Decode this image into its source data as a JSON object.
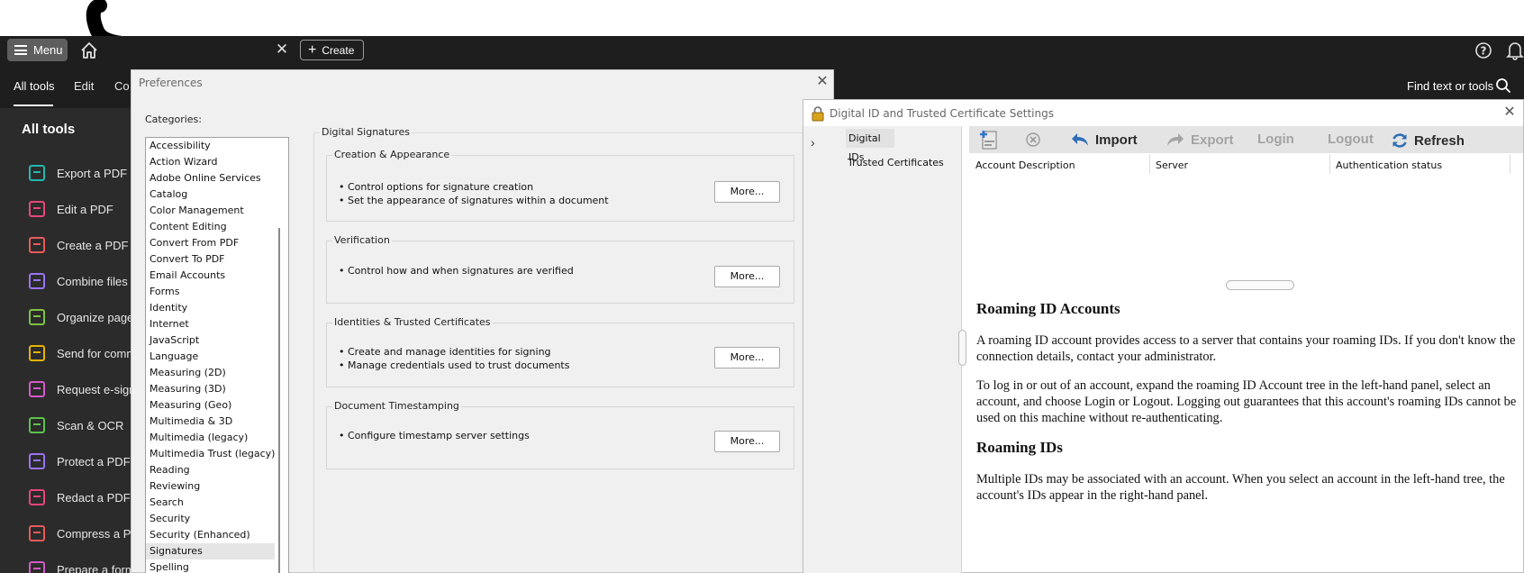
{
  "app": {
    "menu_label": "Menu",
    "create_label": "Create",
    "tabs": [
      "All tools",
      "Edit",
      "Co"
    ],
    "find_text": "Find text or tools"
  },
  "left_panel": {
    "heading": "All tools",
    "items": [
      {
        "label": "Export a PDF",
        "icon": "export-pdf-icon",
        "color": "#22b8b0"
      },
      {
        "label": "Edit a PDF",
        "icon": "edit-pdf-icon",
        "color": "#e8457a"
      },
      {
        "label": "Create a PDF",
        "icon": "create-pdf-icon",
        "color": "#ea5a5a"
      },
      {
        "label": "Combine files",
        "icon": "combine-files-icon",
        "color": "#9a74f2"
      },
      {
        "label": "Organize page",
        "icon": "organize-pages-icon",
        "color": "#7cc33f"
      },
      {
        "label": "Send for comm",
        "icon": "send-comments-icon",
        "color": "#e8b400"
      },
      {
        "label": "Request e-sign",
        "icon": "request-esign-icon",
        "color": "#d658c9"
      },
      {
        "label": "Scan & OCR",
        "icon": "scan-ocr-icon",
        "color": "#5cc34a"
      },
      {
        "label": "Protect a PDF",
        "icon": "protect-pdf-icon",
        "color": "#9a74f2"
      },
      {
        "label": "Redact a PDF",
        "icon": "redact-pdf-icon",
        "color": "#e8457a"
      },
      {
        "label": "Compress a PD",
        "icon": "compress-pdf-icon",
        "color": "#ea5a5a"
      },
      {
        "label": "Prepare a form",
        "icon": "prepare-form-icon",
        "color": "#d658c9"
      }
    ]
  },
  "preferences": {
    "title": "Preferences",
    "categories_label": "Categories:",
    "categories": [
      "Accessibility",
      "Action Wizard",
      "Adobe Online Services",
      "Catalog",
      "Color Management",
      "Content Editing",
      "Convert From PDF",
      "Convert To PDF",
      "Email Accounts",
      "Forms",
      "Identity",
      "Internet",
      "JavaScript",
      "Language",
      "Measuring (2D)",
      "Measuring (3D)",
      "Measuring (Geo)",
      "Multimedia & 3D",
      "Multimedia (legacy)",
      "Multimedia Trust (legacy)",
      "Reading",
      "Reviewing",
      "Search",
      "Security",
      "Security (Enhanced)",
      "Signatures",
      "Spelling"
    ],
    "selected_category": "Signatures",
    "section_title": "Digital Signatures",
    "groups": [
      {
        "title": "Creation & Appearance",
        "lines": [
          "• Control options for signature creation",
          "• Set the appearance of signatures within a document"
        ],
        "button": "More..."
      },
      {
        "title": "Verification",
        "lines": [
          "• Control how and when signatures are verified"
        ],
        "button": "More..."
      },
      {
        "title": "Identities & Trusted Certificates",
        "lines": [
          "• Create and manage identities for signing",
          "• Manage credentials used to trust documents"
        ],
        "button": "More..."
      },
      {
        "title": "Document Timestamping",
        "lines": [
          "• Configure timestamp server settings"
        ],
        "button": "More..."
      }
    ]
  },
  "digital_id": {
    "title": "Digital ID and Trusted Certificate Settings",
    "nav": [
      "Digital IDs",
      "Trusted Certificates"
    ],
    "toolbar": {
      "import": "Import",
      "export": "Export",
      "login": "Login",
      "logout": "Logout",
      "refresh": "Refresh"
    },
    "columns": [
      "Account Description",
      "Server",
      "Authentication status"
    ],
    "help": {
      "h1": "Roaming ID Accounts",
      "p1": "A roaming ID account provides access to a server that contains your roaming IDs. If you don't know the connection details, contact your administrator.",
      "p2": "To log in or out of an account, expand the roaming ID Account tree in the left-hand panel, select an account, and choose Login or Logout. Logging out guarantees that this account's roaming IDs cannot be used on this machine without re-authenticating.",
      "h2": "Roaming IDs",
      "p3": "Multiple IDs may be associated with an account. When you select an account in the left-hand tree, the account's IDs appear in the right-hand panel."
    }
  }
}
